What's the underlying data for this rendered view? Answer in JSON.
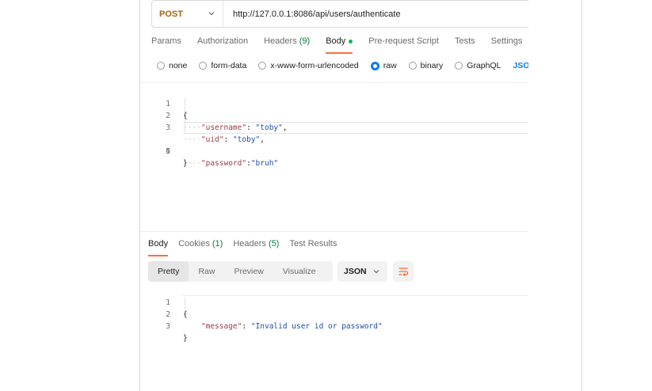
{
  "request": {
    "method": "POST",
    "url": "http://127.0.0.1:8086/api/users/authenticate",
    "tabs": [
      {
        "label": "Params"
      },
      {
        "label": "Authorization"
      },
      {
        "label": "Headers",
        "count": "(9)"
      },
      {
        "label": "Body",
        "active": true
      },
      {
        "label": "Pre-request Script"
      },
      {
        "label": "Tests"
      },
      {
        "label": "Settings"
      }
    ],
    "body_types": [
      "none",
      "form-data",
      "x-www-form-urlencoded",
      "raw",
      "binary",
      "GraphQL"
    ],
    "body_type_selected": "raw",
    "format_link": "JSON",
    "body_lines": [
      {
        "n": "1",
        "text": "{"
      },
      {
        "n": "2",
        "indent": "····",
        "key": "\"username\"",
        "sep": ": ",
        "val": "\"toby\"",
        "end": ","
      },
      {
        "n": "3",
        "indent": "····",
        "key": "\"uid\"",
        "sep": ": ",
        "val": "\"toby\"",
        "end": ","
      },
      {
        "n": "4",
        "indent": "····",
        "key": "\"password\"",
        "sep": ":",
        "val": "\"bruh\"",
        "end": ""
      },
      {
        "n": "5",
        "text": "}"
      }
    ]
  },
  "response": {
    "tabs": [
      {
        "label": "Body",
        "active": true
      },
      {
        "label": "Cookies",
        "count": "(1)"
      },
      {
        "label": "Headers",
        "count": "(5)"
      },
      {
        "label": "Test Results"
      }
    ],
    "views": [
      "Pretty",
      "Raw",
      "Preview",
      "Visualize"
    ],
    "view_selected": "Pretty",
    "format": "JSON",
    "body_lines": [
      {
        "n": "1",
        "text": "{"
      },
      {
        "n": "2",
        "indent": "    ",
        "key": "\"message\"",
        "sep": ": ",
        "val": "\"Invalid user id or password\"",
        "end": ""
      },
      {
        "n": "3",
        "text": "}"
      }
    ]
  },
  "icons": {
    "method_dropdown": "chevron-down-icon",
    "format_dropdown": "chevron-down-icon",
    "wrap": "wrap-lines-icon"
  },
  "colors": {
    "method": "#a8650a",
    "accent": "#ff6c37",
    "link": "#097bed",
    "status_dot": "#0cbb52",
    "json_key": "#9c3b47",
    "json_string": "#1f4fa8"
  }
}
